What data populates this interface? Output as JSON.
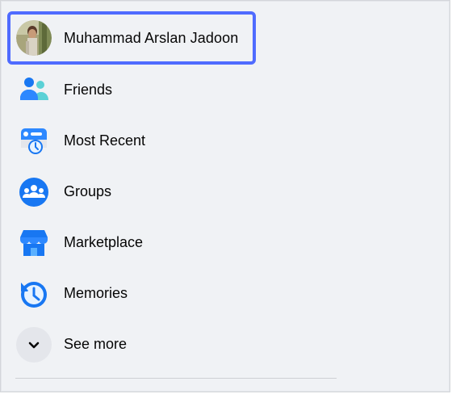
{
  "colors": {
    "accent": "#1877f2",
    "highlight_border": "#4f6bff",
    "panel_bg": "#f0f2f5",
    "text": "#050505"
  },
  "profile": {
    "name": "Muhammad Arslan Jadoon",
    "icon": "avatar"
  },
  "items": [
    {
      "label": "Friends",
      "icon": "friends-icon"
    },
    {
      "label": "Most Recent",
      "icon": "most-recent-icon"
    },
    {
      "label": "Groups",
      "icon": "groups-icon"
    },
    {
      "label": "Marketplace",
      "icon": "marketplace-icon"
    },
    {
      "label": "Memories",
      "icon": "memories-icon"
    },
    {
      "label": "See more",
      "icon": "chevron-down-icon"
    }
  ]
}
